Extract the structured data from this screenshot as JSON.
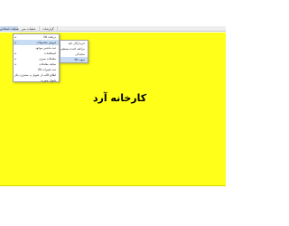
{
  "menubar": {
    "tabs": [
      {
        "label": "عملیات اشخاص"
      },
      {
        "label": "عملیات متن"
      },
      {
        "label": "گزارشات"
      }
    ]
  },
  "menu": {
    "items": [
      {
        "label": "دریافت کالا",
        "arrow": "◂"
      },
      {
        "label": "فروش محصولات",
        "arrow": "◂"
      },
      {
        "label": "ثبت ماشین موجود",
        "arrow": ""
      },
      {
        "label": "استعلامات",
        "arrow": "◂"
      },
      {
        "label": "معاملات سپری",
        "arrow": "◂"
      },
      {
        "label": "سابقه معاملات",
        "arrow": "◂"
      },
      {
        "label": "ثبت تغییرات کالا",
        "arrow": ""
      },
      {
        "label": "اطلاع کالبد بار تحویل به مشتری دیگر",
        "arrow": ""
      },
      {
        "label": "تحویل صورت",
        "arrow": ""
      }
    ]
  },
  "submenu": {
    "items": [
      {
        "label": "خریدارگان عام"
      },
      {
        "label": "مراجعه کننده مستقیم"
      },
      {
        "label": "نمایندگی"
      },
      {
        "label": "نمونه کالا"
      }
    ]
  },
  "banner": {
    "text": "کارخانه آرد"
  },
  "colors": {
    "workspace_background": "#ffff1a",
    "highlight": "#c8dcf4"
  }
}
